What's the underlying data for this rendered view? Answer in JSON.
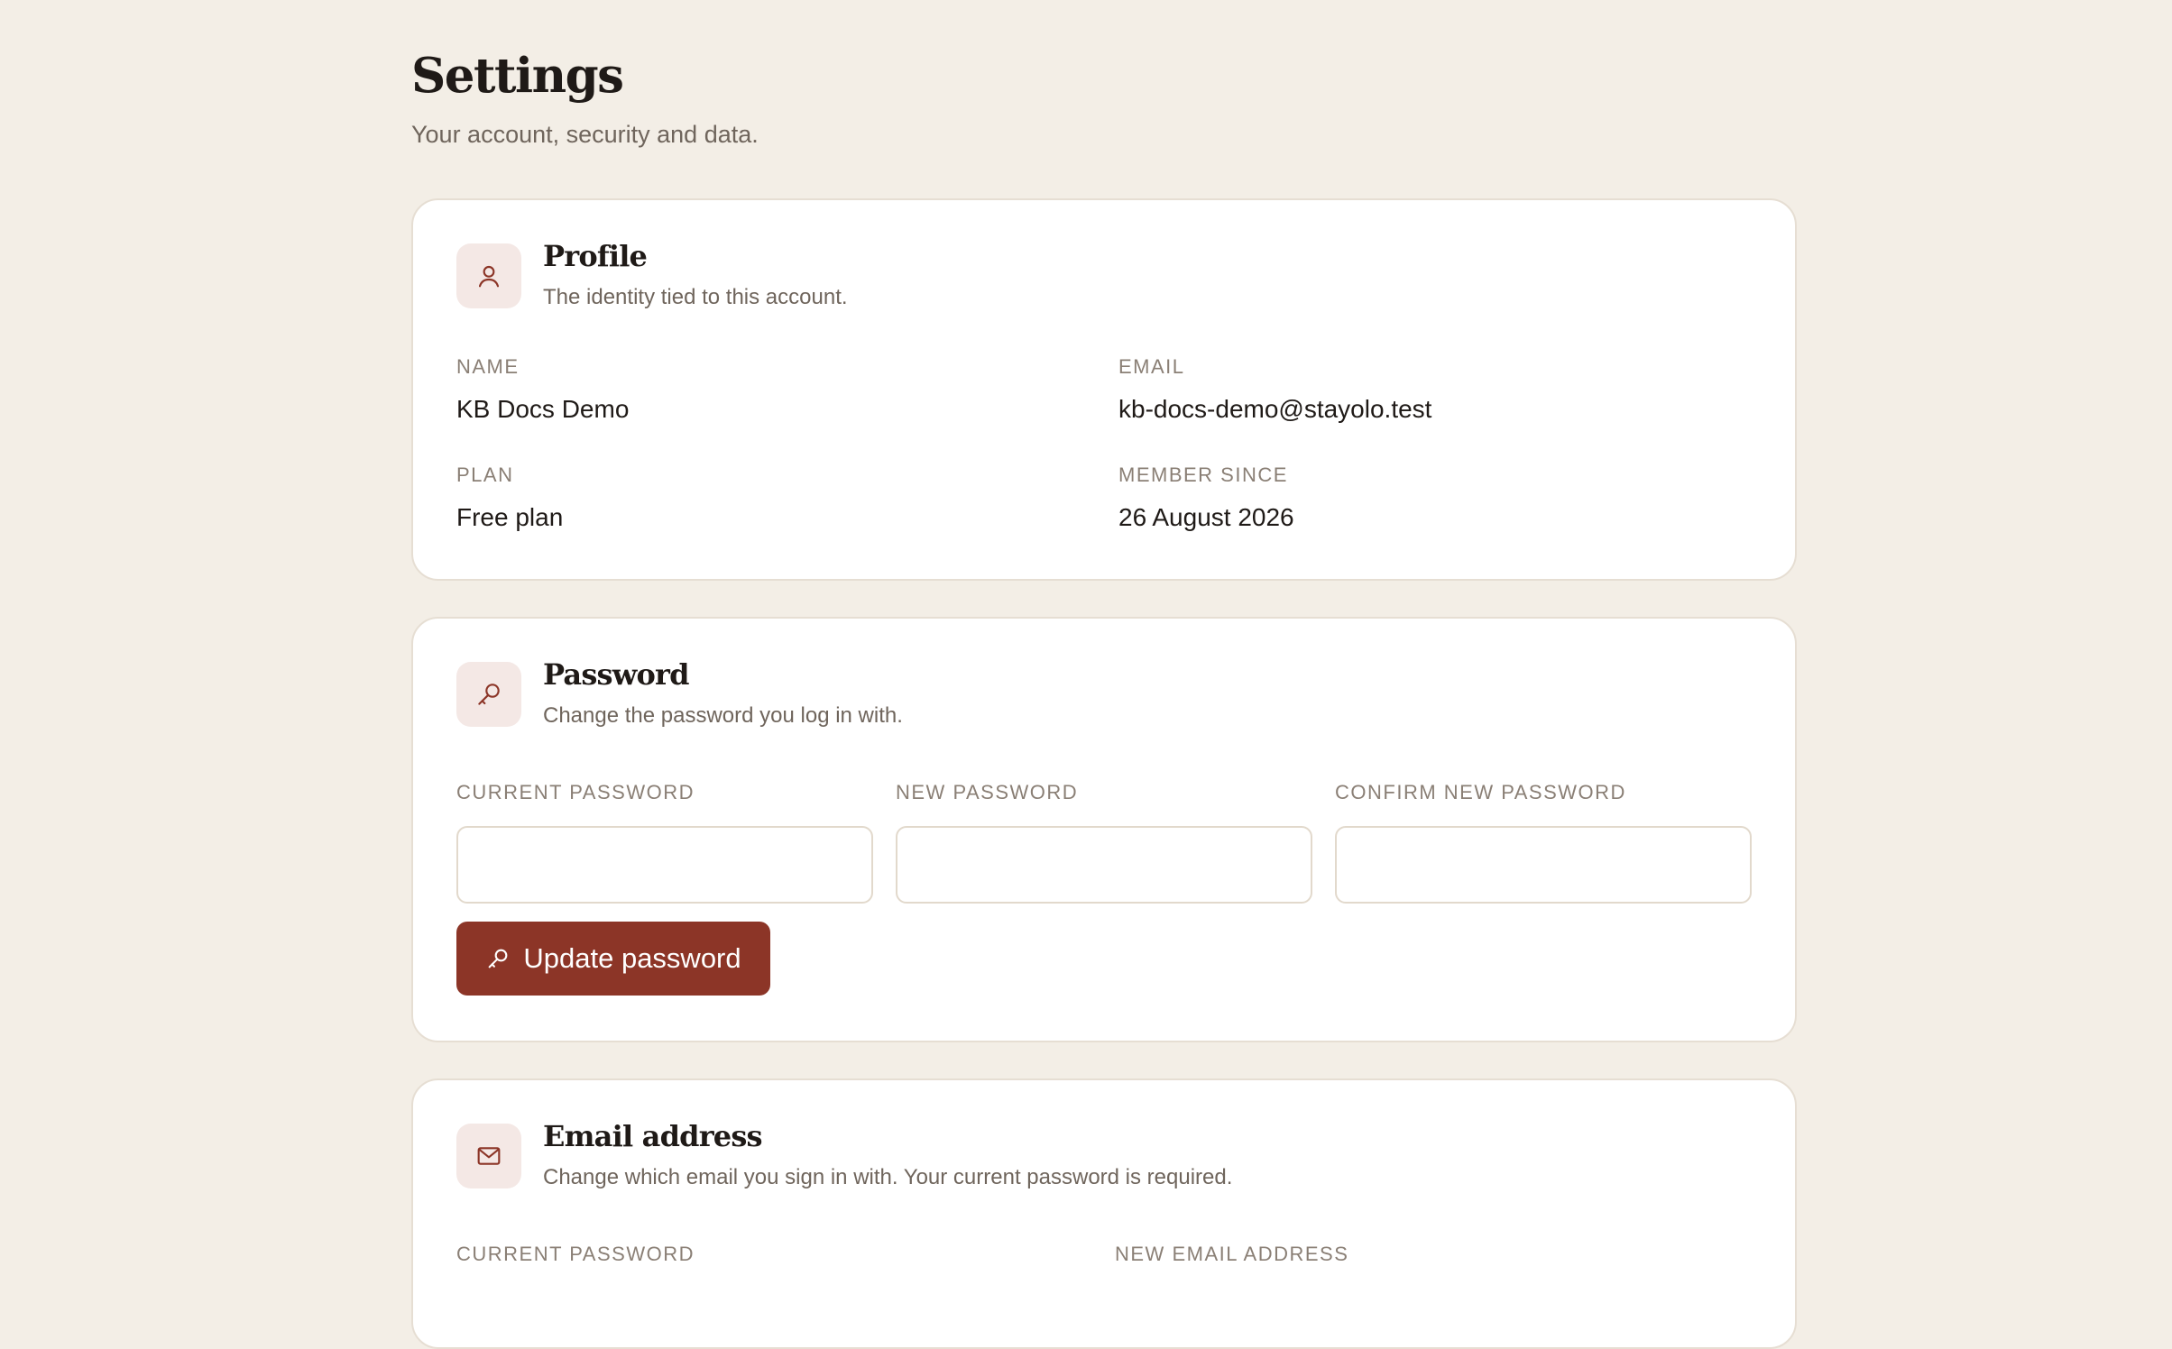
{
  "header": {
    "title": "Settings",
    "subtitle": "Your account, security and data."
  },
  "profile": {
    "icon": "user-icon",
    "title": "Profile",
    "description": "The identity tied to this account.",
    "name_label": "NAME",
    "name_value": "KB Docs Demo",
    "email_label": "EMAIL",
    "email_value": "kb-docs-demo@stayolo.test",
    "plan_label": "PLAN",
    "plan_value": "Free plan",
    "member_since_label": "MEMBER SINCE",
    "member_since_value": "26 August 2026"
  },
  "password": {
    "icon": "key-icon",
    "title": "Password",
    "description": "Change the password you log in with.",
    "current_label": "CURRENT PASSWORD",
    "current_value": "",
    "new_label": "NEW PASSWORD",
    "new_value": "",
    "confirm_label": "CONFIRM NEW PASSWORD",
    "confirm_value": "",
    "button_label": "Update password"
  },
  "email_address": {
    "icon": "mail-icon",
    "title": "Email address",
    "description": "Change which email you sign in with. Your current password is required.",
    "current_password_label": "CURRENT PASSWORD",
    "new_email_label": "NEW EMAIL ADDRESS"
  },
  "colors": {
    "background": "#f3eee6",
    "accent": "#8c3527",
    "icon_tile": "#f4e8e5"
  }
}
